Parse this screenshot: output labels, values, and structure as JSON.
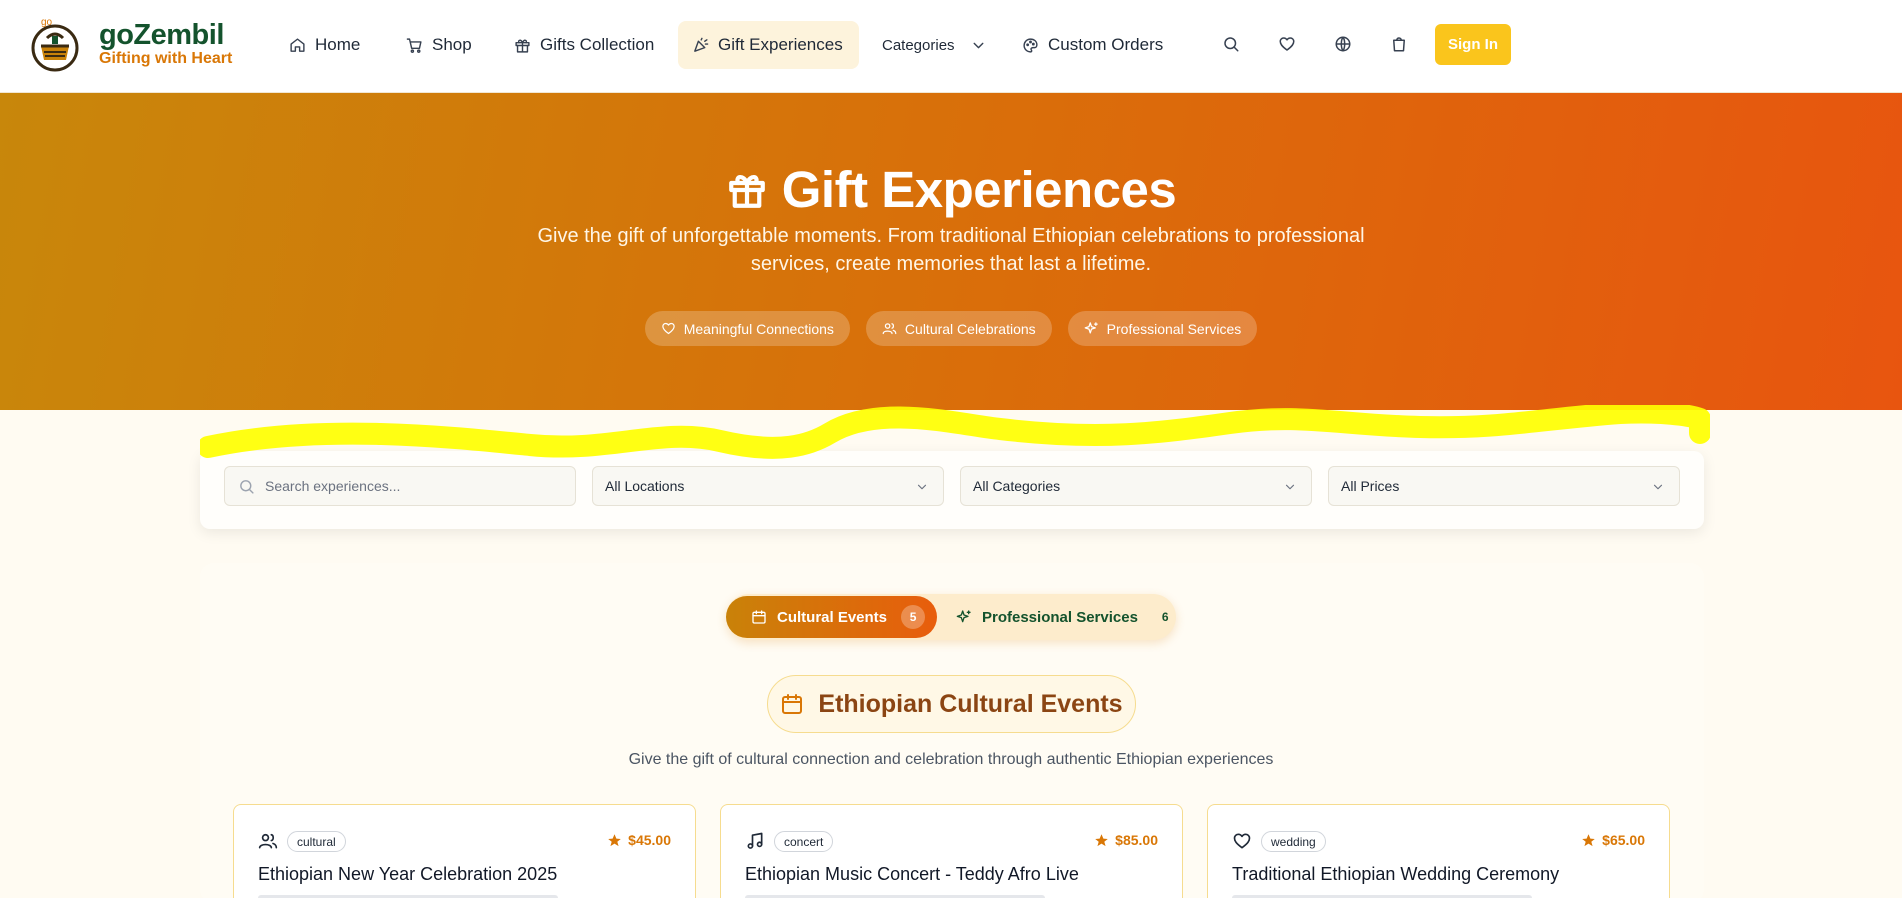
{
  "brand": {
    "name": "goZembil",
    "tagline": "Gifting with Heart",
    "logo_small_text": "go"
  },
  "nav": {
    "items": [
      {
        "label": "Home",
        "icon": "home-icon"
      },
      {
        "label": "Shop",
        "icon": "cart-icon"
      },
      {
        "label": "Gifts Collection",
        "icon": "gift-icon"
      },
      {
        "label": "Gift Experiences",
        "icon": "party-icon",
        "active": true
      },
      {
        "label": "Categories",
        "icon": "chevron-down-icon"
      },
      {
        "label": "Custom Orders",
        "icon": "palette-icon"
      }
    ],
    "sign_in": "Sign In"
  },
  "hero": {
    "title": "Gift Experiences",
    "subtitle": "Give the gift of unforgettable moments. From traditional Ethiopian celebrations to professional services, create memories that last a lifetime.",
    "pills": [
      {
        "label": "Meaningful Connections",
        "icon": "heart-icon"
      },
      {
        "label": "Cultural Celebrations",
        "icon": "users-icon"
      },
      {
        "label": "Professional Services",
        "icon": "sparkles-icon"
      }
    ]
  },
  "filters": {
    "search_placeholder": "Search experiences...",
    "location": "All Locations",
    "category": "All Categories",
    "price": "All Prices"
  },
  "tabs": {
    "cultural": {
      "label": "Cultural Events",
      "count": "5"
    },
    "professional": {
      "label": "Professional Services",
      "count": "6"
    }
  },
  "section": {
    "title": "Ethiopian Cultural Events",
    "subtitle": "Give the gift of cultural connection and celebration through authentic Ethiopian experiences"
  },
  "cards": [
    {
      "tag": "cultural",
      "price": "$45.00",
      "title": "Ethiopian New Year Celebration 2025",
      "icon": "users-icon"
    },
    {
      "tag": "concert",
      "price": "$85.00",
      "title": "Ethiopian Music Concert - Teddy Afro Live",
      "icon": "music-icon"
    },
    {
      "tag": "wedding",
      "price": "$65.00",
      "title": "Traditional Ethiopian Wedding Ceremony",
      "icon": "heart-icon"
    }
  ],
  "colors": {
    "accent": "#d97706",
    "brand_green": "#14532d",
    "sign_in": "#fac51c",
    "hero_start": "#c8870b",
    "hero_end": "#e8550f",
    "highlight": "#ffff00"
  }
}
